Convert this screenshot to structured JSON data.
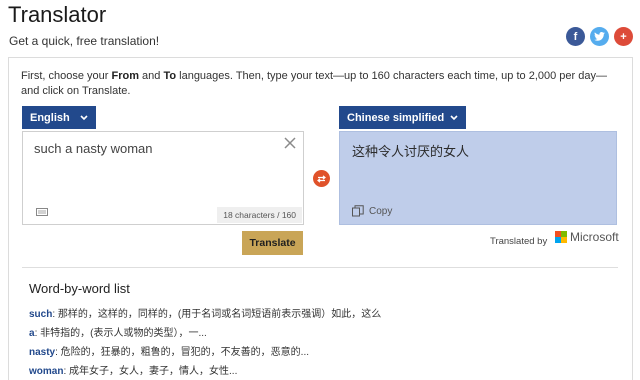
{
  "header": {
    "title": "Translator",
    "subtitle": "Get a quick, free translation!"
  },
  "share": [
    {
      "name": "facebook",
      "glyph": "f",
      "color": "#3b5998"
    },
    {
      "name": "twitter",
      "color": "#55acee"
    },
    {
      "name": "more",
      "glyph": "+",
      "color": "#dd4b39"
    }
  ],
  "instructions": {
    "part1": "First, choose your ",
    "from": "From",
    "part2": " and ",
    "to": "To",
    "part3": " languages. Then, type your text—up to 160 characters each time, up to 2,000 per day—and click on Translate."
  },
  "source": {
    "language": "English",
    "text": "such a nasty woman",
    "char_count": "18 characters / 160"
  },
  "target": {
    "language": "Chinese simplified",
    "text": "这种令人讨厌的女人",
    "copy_label": "Copy"
  },
  "actions": {
    "translate_label": "Translate",
    "translated_by": "Translated by",
    "provider": "Microsoft"
  },
  "word_by_word": {
    "title": "Word-by-word list",
    "items": [
      {
        "word": "such",
        "definition": ": 那样的，这样的，同样的，(用于名词或名词短语前表示强调）如此，这么"
      },
      {
        "word": "a",
        "definition": ": 非特指的，(表示人或物的类型），一..."
      },
      {
        "word": "nasty",
        "definition": ": 危险的，狂暴的，粗鲁的，冒犯的，不友善的，恶意的..."
      },
      {
        "word": "woman",
        "definition": ": 成年女子，女人，妻子，情人，女性..."
      }
    ]
  },
  "colors": {
    "accent": "#22498c",
    "target_bg": "#bfcdea",
    "translate_btn": "#c9a557",
    "swap": "#e0522a"
  }
}
